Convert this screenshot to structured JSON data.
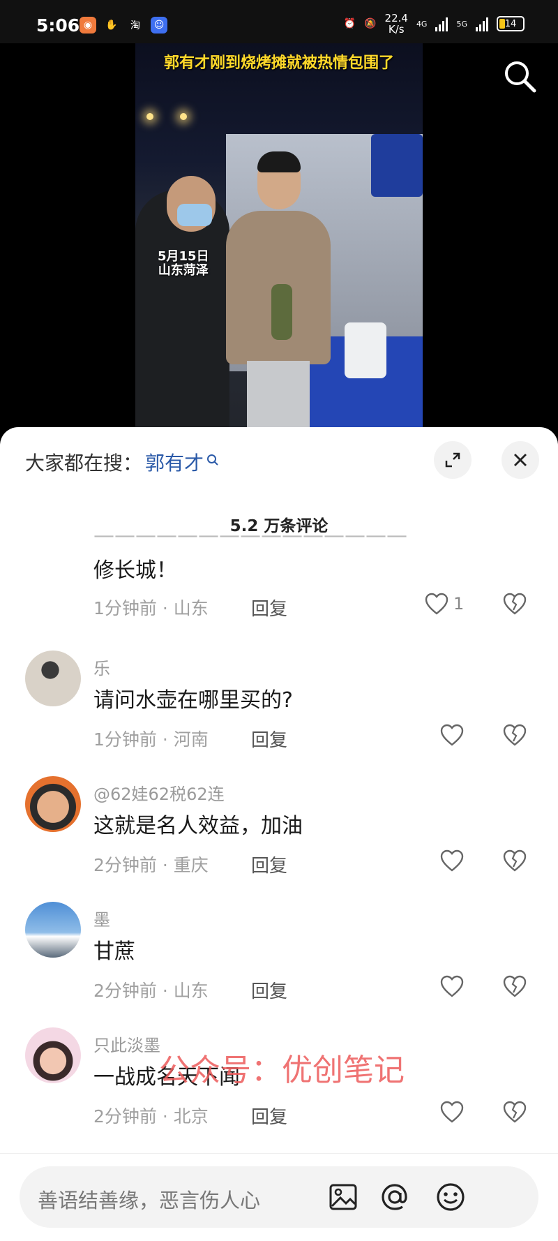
{
  "status_bar": {
    "time": "5:06",
    "app_icons": [
      "app-icon-orange",
      "hand-icon",
      "taobao-icon",
      "blue-app-icon"
    ],
    "taobao_text": "淘",
    "net_speed_value": "22.4",
    "net_speed_unit": "K/s",
    "net_labels": [
      "4G",
      "5G"
    ],
    "battery": "14"
  },
  "video": {
    "caption": "郭有才刚到烧烤摊就被热情包围了",
    "date_line1": "5月15日",
    "date_line2": "山东菏泽"
  },
  "sheet": {
    "trend_prefix": "大家都在搜：",
    "trend_keyword": "郭有才",
    "comment_count": "5.2 万条评论"
  },
  "comments": [
    {
      "user": "",
      "text": "修长城！",
      "time": "1分钟前",
      "region": "山东",
      "reply": "回复",
      "likes": "1"
    },
    {
      "user": "乐",
      "text": "请问水壶在哪里买的?",
      "time": "1分钟前",
      "region": "河南",
      "reply": "回复",
      "likes": ""
    },
    {
      "user": "@62娃62税62连",
      "text": "这就是名人效益，加油",
      "time": "2分钟前",
      "region": "重庆",
      "reply": "回复",
      "likes": ""
    },
    {
      "user": "墨",
      "text": "甘蔗",
      "time": "2分钟前",
      "region": "山东",
      "reply": "回复",
      "likes": ""
    },
    {
      "user": "只此淡墨",
      "text": "一战成名天下闻",
      "time": "2分钟前",
      "region": "北京",
      "reply": "回复",
      "likes": ""
    }
  ],
  "watermark": "公众号：优创笔记",
  "input": {
    "placeholder": "善语结善缘，恶言伤人心"
  },
  "colors": {
    "link_blue": "#2b5aa8",
    "caption_yellow": "#ffd92a",
    "watermark_red": "#ec5a5a"
  }
}
